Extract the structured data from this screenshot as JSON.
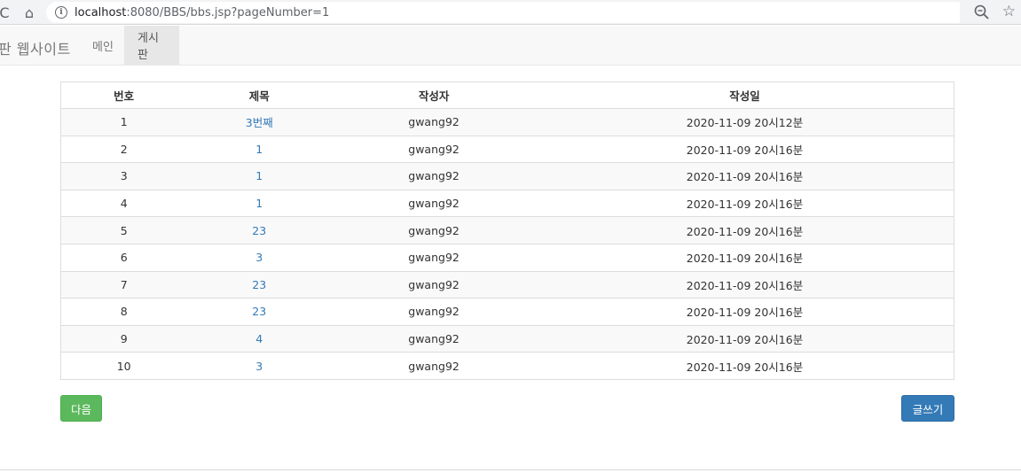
{
  "browser": {
    "url_host": "localhost",
    "url_path": ":8080/BBS/bbs.jsp?pageNumber=1",
    "reload_glyph": "C",
    "home_glyph": "⌂",
    "info_glyph": "i",
    "star_glyph": "☆"
  },
  "navbar": {
    "brand": "판 웹사이트",
    "items": [
      {
        "label": "메인"
      },
      {
        "label": "게시판"
      }
    ]
  },
  "table": {
    "headers": [
      "번호",
      "제목",
      "작성자",
      "작성일"
    ],
    "rows": [
      {
        "no": "1",
        "title": "3번째",
        "author": "gwang92",
        "date": "2020-11-09 20시12분"
      },
      {
        "no": "2",
        "title": "1",
        "author": "gwang92",
        "date": "2020-11-09 20시16분"
      },
      {
        "no": "3",
        "title": "1",
        "author": "gwang92",
        "date": "2020-11-09 20시16분"
      },
      {
        "no": "4",
        "title": "1",
        "author": "gwang92",
        "date": "2020-11-09 20시16분"
      },
      {
        "no": "5",
        "title": "23",
        "author": "gwang92",
        "date": "2020-11-09 20시16분"
      },
      {
        "no": "6",
        "title": "3",
        "author": "gwang92",
        "date": "2020-11-09 20시16분"
      },
      {
        "no": "7",
        "title": "23",
        "author": "gwang92",
        "date": "2020-11-09 20시16분"
      },
      {
        "no": "8",
        "title": "23",
        "author": "gwang92",
        "date": "2020-11-09 20시16분"
      },
      {
        "no": "9",
        "title": "4",
        "author": "gwang92",
        "date": "2020-11-09 20시16분"
      },
      {
        "no": "10",
        "title": "3",
        "author": "gwang92",
        "date": "2020-11-09 20시16분"
      }
    ]
  },
  "buttons": {
    "next_label": "다음",
    "write_label": "글쓰기"
  },
  "colors": {
    "link": "#337ab7",
    "next_button": "#5cb85c",
    "write_button": "#337ab7"
  }
}
